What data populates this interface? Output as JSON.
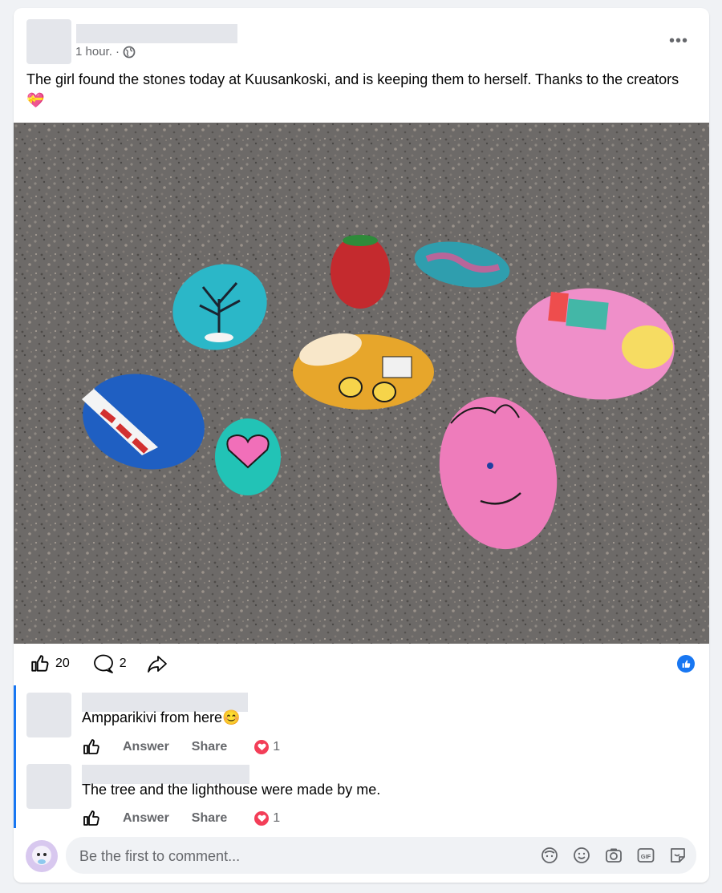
{
  "post": {
    "time": "1 hour. ·",
    "text": "The girl found the stones today at Kuusankoski, and is keeping them to herself. Thanks to the creators💝",
    "photo_alt": "Painted stones on asphalt"
  },
  "actions": {
    "like_count": "20",
    "comment_count": "2"
  },
  "comments": [
    {
      "text": "Ampparikivi from here😊",
      "answer": "Answer",
      "share": "Share",
      "reactions": "1"
    },
    {
      "text": "The tree and the lighthouse were made by me.",
      "answer": "Answer",
      "share": "Share",
      "reactions": "1"
    }
  ],
  "composer": {
    "placeholder": "Be the first to comment..."
  },
  "icons": [
    "globe-icon",
    "more-icon",
    "like-icon",
    "comment-icon",
    "share-icon",
    "like-badge-icon",
    "heart-icon",
    "avatar-sticker-icon",
    "emoji-icon",
    "camera-icon",
    "gif-icon",
    "sticker-icon"
  ],
  "colors": {
    "accent": "#1877f2",
    "heart": "#f33e58",
    "muted": "#65676b"
  }
}
